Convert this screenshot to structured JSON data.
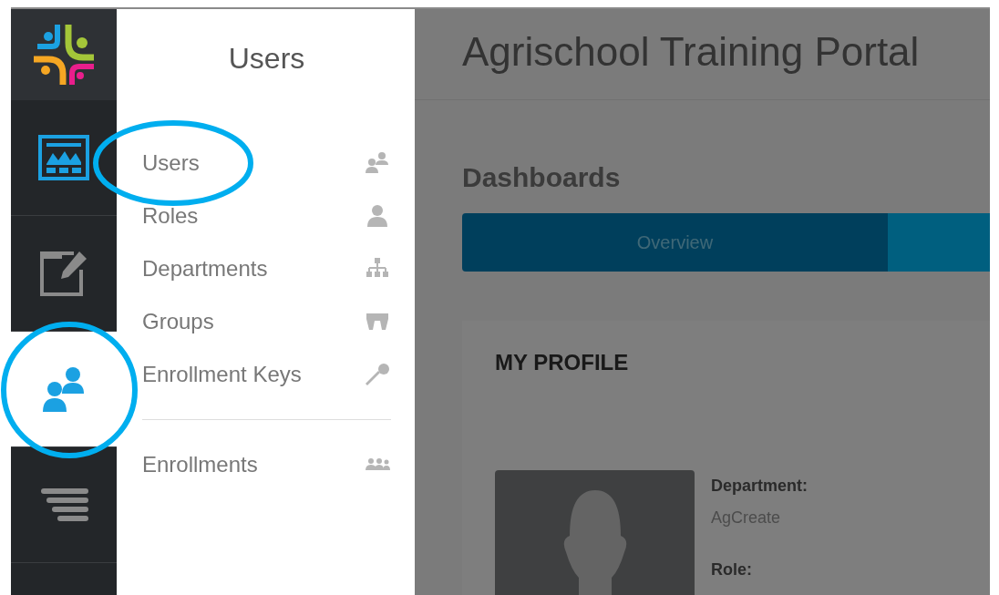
{
  "rail": {
    "items": [
      {
        "kind": "dashboard",
        "selected": false,
        "circled": false
      },
      {
        "kind": "edit",
        "selected": false,
        "circled": false
      },
      {
        "kind": "users",
        "selected": true,
        "circled": true
      },
      {
        "kind": "list",
        "selected": false,
        "circled": false
      }
    ]
  },
  "submenu": {
    "title": "Users",
    "groups": [
      [
        {
          "label": "Users",
          "kind": "users",
          "circled": true
        },
        {
          "label": "Roles",
          "kind": "person",
          "circled": false
        },
        {
          "label": "Departments",
          "kind": "hierarchy",
          "circled": false
        },
        {
          "label": "Groups",
          "kind": "group",
          "circled": false
        },
        {
          "label": "Enrollment Keys",
          "kind": "key",
          "circled": false
        }
      ],
      [
        {
          "label": "Enrollments",
          "kind": "people",
          "circled": false
        }
      ]
    ]
  },
  "main": {
    "dimmed": true,
    "title": "Agrischool Training Portal",
    "section": "Dashboards",
    "tabs": [
      {
        "label": "Overview",
        "selected": true
      },
      {
        "selected": false
      }
    ],
    "profile": {
      "heading": "MY PROFILE",
      "fields": [
        {
          "label": "Department:",
          "value": "AgCreate"
        },
        {
          "label": "Role:"
        }
      ]
    }
  }
}
